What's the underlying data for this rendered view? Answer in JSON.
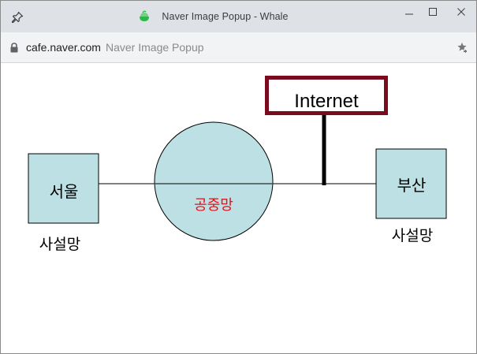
{
  "window": {
    "title": "Naver Image Popup - Whale"
  },
  "address_bar": {
    "domain": "cafe.naver.com",
    "page_title": "Naver Image Popup"
  },
  "diagram": {
    "internet_label": "Internet",
    "seoul_label": "서울",
    "busan_label": "부산",
    "public_network_label": "공중망",
    "private_network_left_label": "사설망",
    "private_network_right_label": "사설망"
  },
  "colors": {
    "box_fill": "#bde0e4",
    "internet_border": "#7a0a1e",
    "public_network_text": "#e0121a",
    "titlebar_bg": "#dee1e6",
    "urlbar_bg": "#f1f3f4"
  },
  "icons": {
    "pin": "pin-icon",
    "app": "whale-app-icon",
    "minimize": "minimize-icon",
    "maximize": "maximize-icon",
    "close": "close-icon",
    "lock": "lock-icon",
    "extension": "extension-icon"
  }
}
